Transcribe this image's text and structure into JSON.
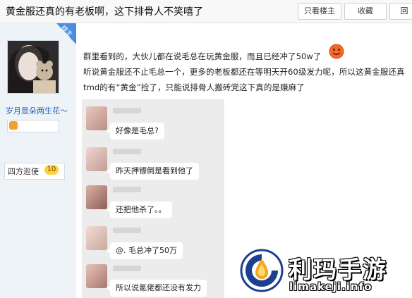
{
  "header": {
    "title": "黄金服还真的有老板啊，这下排骨人不笑嘻了",
    "only_owner": "只看楼主",
    "favorite": "收藏",
    "share": "回"
  },
  "profile": {
    "owner_tag": "楼主",
    "username": "岁月是朵两生花～",
    "rank": "四方巡使",
    "level": "10"
  },
  "post": {
    "lines": [
      "群里看到的，大伙儿都在说毛总在玩黄金服，而且已经冲了50w了",
      "听说黄金服还不止毛总一个，更多的老板都还在等明天开60级发力呢，所以这黄金服还真",
      "tmd的有“黄金”捡了，只能说排骨人搬砖党这下真的是赚麻了"
    ]
  },
  "chat": {
    "messages": [
      "好像是毛总?",
      "昨天押镖倒是看到他了",
      "还把他杀了。。",
      "@. 毛总冲了50万",
      "所以说氪佬都还没有发力"
    ]
  },
  "watermark": {
    "name": "利玛手游",
    "url": "limakeji.info"
  },
  "colors": {
    "accent": "#2b63b5",
    "owner_tag": "#4a8ee0",
    "chat_bg": "#ececec"
  }
}
